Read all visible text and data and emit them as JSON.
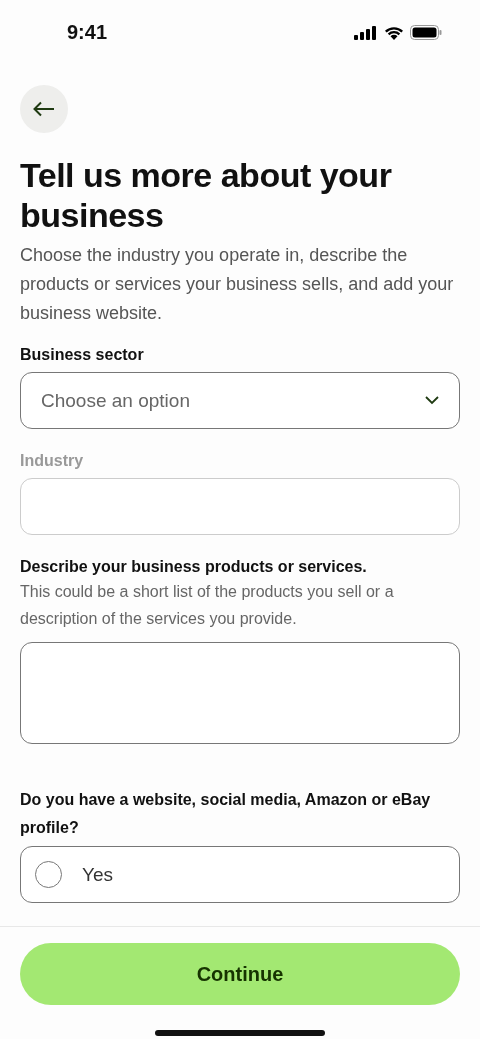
{
  "status_bar": {
    "time": "9:41"
  },
  "title": "Tell us more about your business",
  "description": "Choose the industry you operate in, describe the products or services your business sells, and add your business website.",
  "fields": [
    {
      "kind": "select",
      "label": "Business sector",
      "placeholder": "Choose an option",
      "disabled": false
    },
    {
      "kind": "text",
      "label": "Industry",
      "disabled": true
    },
    {
      "kind": "textarea",
      "label": "Describe your business products or services.",
      "hint": "This could be a short list of the products you sell or a description of the services you provide.",
      "disabled": false
    }
  ],
  "question": {
    "label": "Do you have a website, social media, Amazon or eBay profile?",
    "options": [
      {
        "label": "Yes",
        "selected": false
      }
    ]
  },
  "continue_button": "Continue"
}
